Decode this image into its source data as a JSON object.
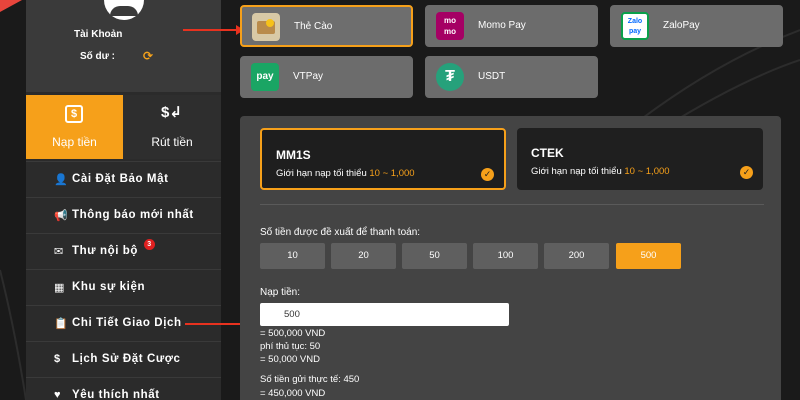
{
  "account": {
    "name": "Tài Khoản",
    "balance_label": "Số dư :"
  },
  "tabs": {
    "deposit": "Nạp tiền",
    "withdraw": "Rút tiền"
  },
  "menu": [
    {
      "label": "Cài Đặt Bảo Mật",
      "icon": "user-lock-icon",
      "glyph": "👤"
    },
    {
      "label": "Thông báo mới nhất",
      "icon": "bullhorn-icon",
      "glyph": "📢"
    },
    {
      "label": "Thư nội bộ",
      "icon": "envelope-icon",
      "glyph": "✉",
      "badge": "3"
    },
    {
      "label": "Khu sự kiện",
      "icon": "calendar-icon",
      "glyph": "▦"
    },
    {
      "label": "Chi Tiết Giao Dịch",
      "icon": "clipboard-icon",
      "glyph": "📋"
    },
    {
      "label": "Lịch Sử Đặt Cược",
      "icon": "dollar-circle-icon",
      "glyph": "$"
    },
    {
      "label": "Yêu thích nhất",
      "icon": "heart-icon",
      "glyph": "♥"
    }
  ],
  "payment_methods": [
    {
      "label": "Thẻ Cào",
      "active": true
    },
    {
      "label": "Momo Pay",
      "active": false
    },
    {
      "label": "ZaloPay",
      "active": false
    },
    {
      "label": "VTPay",
      "active": false
    },
    {
      "label": "USDT",
      "active": false
    }
  ],
  "logo_text": {
    "momo_top": "mo",
    "momo_bottom": "mo",
    "zalo_top": "Zalo",
    "zalo_bottom": "pay",
    "vtpay": "pay",
    "usdt": "₮"
  },
  "providers": [
    {
      "name": "MM1S",
      "limit_prefix": "Giới hạn nạp tối thiểu",
      "limit_range": "10 ~ 1,000",
      "active": true
    },
    {
      "name": "CTEK",
      "limit_prefix": "Giới hạn nạp tối thiểu",
      "limit_range": "10 ~ 1,000",
      "active": false
    }
  ],
  "suggest_label": "Số tiền được đề xuất để thanh toán:",
  "amounts": [
    "10",
    "20",
    "50",
    "100",
    "200",
    "500"
  ],
  "selected_amount": "500",
  "deposit": {
    "label": "Nạp tiền:",
    "value": "500"
  },
  "calc": {
    "converted": "= 500,000 VND",
    "fee_label": "phí thủ tục:    50",
    "fee_value": "= 50,000 VND",
    "actual_label": "Số tiền gửi thực tế:    450",
    "actual_value": "= 450,000 VND"
  },
  "colors": {
    "accent": "#f6a01a",
    "arrow": "#e8321f",
    "momo": "#a50064",
    "zalo": "#0068ff",
    "vtpay": "#1aa564",
    "usdt": "#26a17b"
  }
}
